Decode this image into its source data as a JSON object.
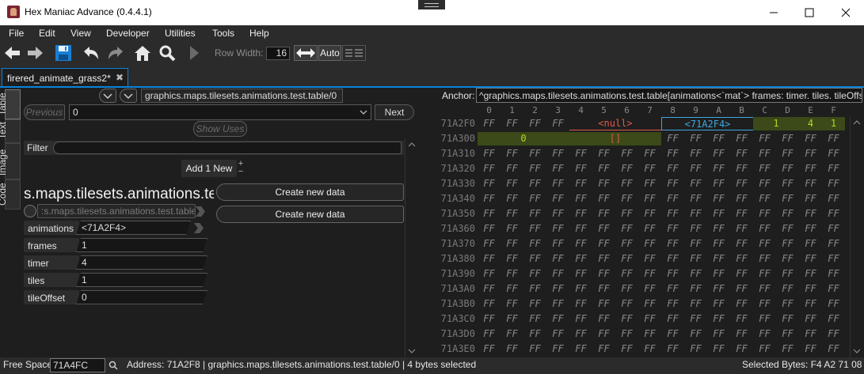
{
  "window": {
    "title": "Hex Maniac Advance (0.4.4.1)"
  },
  "menu": [
    "File",
    "Edit",
    "View",
    "Developer",
    "Utilities",
    "Tools",
    "Help"
  ],
  "toolbar": {
    "row_width_label": "Row Width:",
    "row_width_value": "16",
    "auto_label": "Auto"
  },
  "tabs": [
    {
      "label": "firered_animate_grass2*",
      "close": "✖"
    }
  ],
  "left": {
    "side_tabs": [
      "Table",
      "Text",
      "Image",
      "Code"
    ],
    "table_path": "graphics.maps.tilesets.animations.test.table/0",
    "previous_label": "Previous",
    "index_value": "0",
    "next_label": "Next",
    "show_uses_label": "Show Uses",
    "filter_label": "Filter",
    "add_new_label": "Add 1 New",
    "big_title": "s.maps.tilesets.animations.te",
    "sub_path": ":s.maps.tilesets.animations.test.table",
    "create_new_labels": [
      "Create new data",
      "Create new data"
    ],
    "fields": [
      {
        "label": "animations",
        "value": "<71A2F4>"
      },
      {
        "label": "frames",
        "value": "1"
      },
      {
        "label": "timer",
        "value": "4"
      },
      {
        "label": "tiles",
        "value": "1"
      },
      {
        "label": "tileOffset",
        "value": "0"
      }
    ]
  },
  "right": {
    "anchor_label": "Anchor:",
    "anchor_value": "^graphics.maps.tilesets.animations.test.table[animations<`mat`> frames: timer. tiles. tileOffset]",
    "columns": [
      "0",
      "1",
      "2",
      "3",
      "4",
      "5",
      "6",
      "7",
      "8",
      "9",
      "A",
      "B",
      "C",
      "D",
      "E",
      "F"
    ],
    "rows": [
      "71A2F0",
      "71A300",
      "71A310",
      "71A320",
      "71A330",
      "71A340",
      "71A350",
      "71A360",
      "71A370",
      "71A380",
      "71A390",
      "71A3A0",
      "71A3B0",
      "71A3C0",
      "71A3D0",
      "71A3E0"
    ],
    "filler": "FF",
    "row0_segments": {
      "null_ptr": "<null>",
      "ptr": "<71A2F4>",
      "frames": "1",
      "timer": "4",
      "tiles": "1"
    },
    "row1_segments": {
      "tile_offset": "0",
      "empty_array": "[]"
    },
    "colors": {
      "null_ptr": "#e05a4a",
      "ptr": "#3fa7e0",
      "numeric_bg": "#3b4a18",
      "numeric_text": "#b5d81f"
    }
  },
  "status": {
    "free_space_label": "Free Space:",
    "free_space_value": "71A4FC",
    "address_text": "Address: 71A2F8 | graphics.maps.tilesets.animations.test.table/0 | 4 bytes selected",
    "selected_bytes": "Selected Bytes: F4 A2 71 08"
  }
}
